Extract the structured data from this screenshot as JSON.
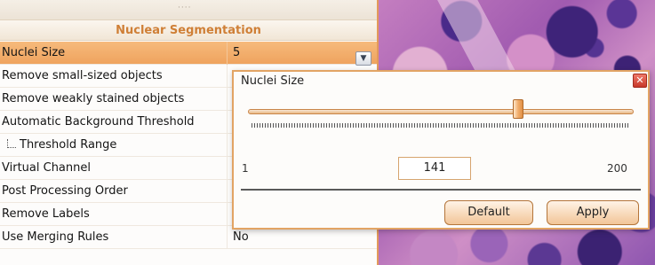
{
  "panel": {
    "grip": "····",
    "section_title": "Nuclear Segmentation",
    "rows": [
      {
        "label": "Nuclei Size",
        "value": "5"
      },
      {
        "label": "Remove small-sized objects",
        "value": ""
      },
      {
        "label": "Remove weakly stained objects",
        "value": ""
      },
      {
        "label": "Automatic Background Threshold",
        "value": ""
      },
      {
        "label": "Threshold Range",
        "value": ""
      },
      {
        "label": "Virtual Channel",
        "value": ""
      },
      {
        "label": "Post Processing Order",
        "value": ""
      },
      {
        "label": "Remove Labels",
        "value": ""
      },
      {
        "label": "Use Merging Rules",
        "value": "No"
      }
    ],
    "dropdown_icon": "chevron-down-icon"
  },
  "popup": {
    "title": "Nuclei Size",
    "close_icon": "close-icon",
    "slider": {
      "min_label": "1",
      "max_label": "200",
      "value": "141",
      "fraction": 0.7
    },
    "buttons": {
      "default": "Default",
      "apply": "Apply"
    }
  },
  "colors": {
    "accent_orange": "#e2a464",
    "section_title": "#cf7f36",
    "selected_row": "#f2ae6b",
    "close_red": "#d2483a"
  }
}
